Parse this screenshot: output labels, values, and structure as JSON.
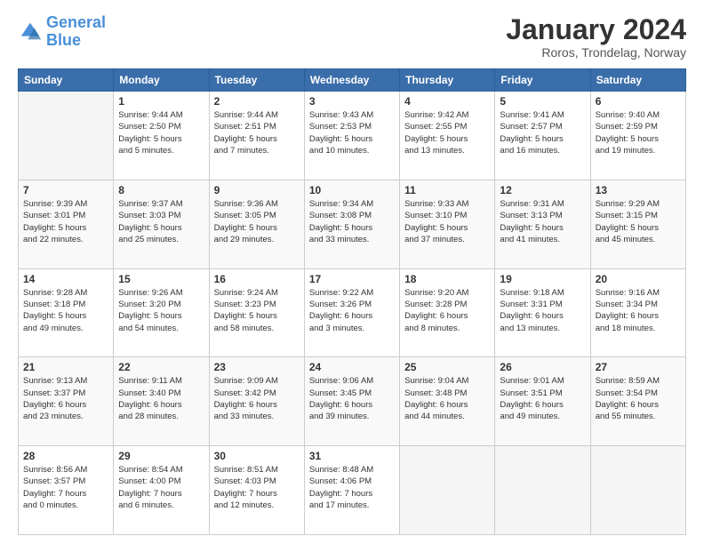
{
  "header": {
    "logo_line1": "General",
    "logo_line2": "Blue",
    "title": "January 2024",
    "subtitle": "Roros, Trondelag, Norway"
  },
  "calendar": {
    "headers": [
      "Sunday",
      "Monday",
      "Tuesday",
      "Wednesday",
      "Thursday",
      "Friday",
      "Saturday"
    ],
    "weeks": [
      [
        {
          "day": "",
          "info": ""
        },
        {
          "day": "1",
          "info": "Sunrise: 9:44 AM\nSunset: 2:50 PM\nDaylight: 5 hours\nand 5 minutes."
        },
        {
          "day": "2",
          "info": "Sunrise: 9:44 AM\nSunset: 2:51 PM\nDaylight: 5 hours\nand 7 minutes."
        },
        {
          "day": "3",
          "info": "Sunrise: 9:43 AM\nSunset: 2:53 PM\nDaylight: 5 hours\nand 10 minutes."
        },
        {
          "day": "4",
          "info": "Sunrise: 9:42 AM\nSunset: 2:55 PM\nDaylight: 5 hours\nand 13 minutes."
        },
        {
          "day": "5",
          "info": "Sunrise: 9:41 AM\nSunset: 2:57 PM\nDaylight: 5 hours\nand 16 minutes."
        },
        {
          "day": "6",
          "info": "Sunrise: 9:40 AM\nSunset: 2:59 PM\nDaylight: 5 hours\nand 19 minutes."
        }
      ],
      [
        {
          "day": "7",
          "info": "Sunrise: 9:39 AM\nSunset: 3:01 PM\nDaylight: 5 hours\nand 22 minutes."
        },
        {
          "day": "8",
          "info": "Sunrise: 9:37 AM\nSunset: 3:03 PM\nDaylight: 5 hours\nand 25 minutes."
        },
        {
          "day": "9",
          "info": "Sunrise: 9:36 AM\nSunset: 3:05 PM\nDaylight: 5 hours\nand 29 minutes."
        },
        {
          "day": "10",
          "info": "Sunrise: 9:34 AM\nSunset: 3:08 PM\nDaylight: 5 hours\nand 33 minutes."
        },
        {
          "day": "11",
          "info": "Sunrise: 9:33 AM\nSunset: 3:10 PM\nDaylight: 5 hours\nand 37 minutes."
        },
        {
          "day": "12",
          "info": "Sunrise: 9:31 AM\nSunset: 3:13 PM\nDaylight: 5 hours\nand 41 minutes."
        },
        {
          "day": "13",
          "info": "Sunrise: 9:29 AM\nSunset: 3:15 PM\nDaylight: 5 hours\nand 45 minutes."
        }
      ],
      [
        {
          "day": "14",
          "info": "Sunrise: 9:28 AM\nSunset: 3:18 PM\nDaylight: 5 hours\nand 49 minutes."
        },
        {
          "day": "15",
          "info": "Sunrise: 9:26 AM\nSunset: 3:20 PM\nDaylight: 5 hours\nand 54 minutes."
        },
        {
          "day": "16",
          "info": "Sunrise: 9:24 AM\nSunset: 3:23 PM\nDaylight: 5 hours\nand 58 minutes."
        },
        {
          "day": "17",
          "info": "Sunrise: 9:22 AM\nSunset: 3:26 PM\nDaylight: 6 hours\nand 3 minutes."
        },
        {
          "day": "18",
          "info": "Sunrise: 9:20 AM\nSunset: 3:28 PM\nDaylight: 6 hours\nand 8 minutes."
        },
        {
          "day": "19",
          "info": "Sunrise: 9:18 AM\nSunset: 3:31 PM\nDaylight: 6 hours\nand 13 minutes."
        },
        {
          "day": "20",
          "info": "Sunrise: 9:16 AM\nSunset: 3:34 PM\nDaylight: 6 hours\nand 18 minutes."
        }
      ],
      [
        {
          "day": "21",
          "info": "Sunrise: 9:13 AM\nSunset: 3:37 PM\nDaylight: 6 hours\nand 23 minutes."
        },
        {
          "day": "22",
          "info": "Sunrise: 9:11 AM\nSunset: 3:40 PM\nDaylight: 6 hours\nand 28 minutes."
        },
        {
          "day": "23",
          "info": "Sunrise: 9:09 AM\nSunset: 3:42 PM\nDaylight: 6 hours\nand 33 minutes."
        },
        {
          "day": "24",
          "info": "Sunrise: 9:06 AM\nSunset: 3:45 PM\nDaylight: 6 hours\nand 39 minutes."
        },
        {
          "day": "25",
          "info": "Sunrise: 9:04 AM\nSunset: 3:48 PM\nDaylight: 6 hours\nand 44 minutes."
        },
        {
          "day": "26",
          "info": "Sunrise: 9:01 AM\nSunset: 3:51 PM\nDaylight: 6 hours\nand 49 minutes."
        },
        {
          "day": "27",
          "info": "Sunrise: 8:59 AM\nSunset: 3:54 PM\nDaylight: 6 hours\nand 55 minutes."
        }
      ],
      [
        {
          "day": "28",
          "info": "Sunrise: 8:56 AM\nSunset: 3:57 PM\nDaylight: 7 hours\nand 0 minutes."
        },
        {
          "day": "29",
          "info": "Sunrise: 8:54 AM\nSunset: 4:00 PM\nDaylight: 7 hours\nand 6 minutes."
        },
        {
          "day": "30",
          "info": "Sunrise: 8:51 AM\nSunset: 4:03 PM\nDaylight: 7 hours\nand 12 minutes."
        },
        {
          "day": "31",
          "info": "Sunrise: 8:48 AM\nSunset: 4:06 PM\nDaylight: 7 hours\nand 17 minutes."
        },
        {
          "day": "",
          "info": ""
        },
        {
          "day": "",
          "info": ""
        },
        {
          "day": "",
          "info": ""
        }
      ]
    ]
  }
}
